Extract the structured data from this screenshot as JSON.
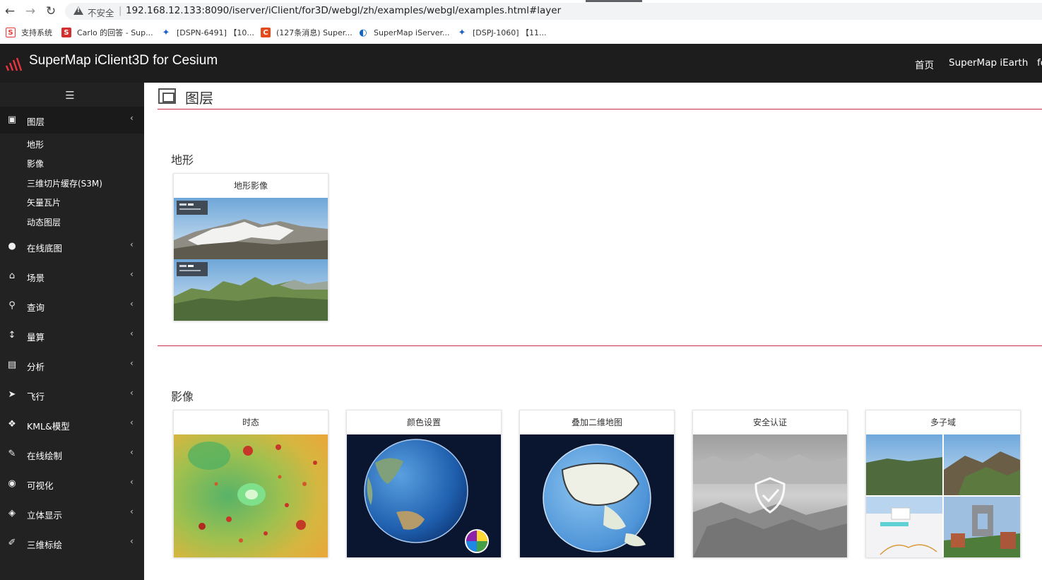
{
  "browser": {
    "back_icon": "arrow-left-icon",
    "forward_icon": "arrow-right-icon",
    "reload_icon": "reload-icon",
    "insecure_label": "不安全",
    "url": "192.168.12.133:8090/iserver/iClient/for3D/webgl/zh/examples/webgl/examples.html#layer"
  },
  "bookmarks": [
    {
      "label": "支持系统",
      "color": "#e53935",
      "glyph": "S"
    },
    {
      "label": "Carlo 的回答 - Sup...",
      "color": "#d32f2f",
      "glyph": "S"
    },
    {
      "label": "[DSPN-6491] 【10...",
      "color": "#1e63c8",
      "glyph": "✦"
    },
    {
      "label": "(127条消息) Super...",
      "color": "#e64a19",
      "glyph": "C"
    },
    {
      "label": "SuperMap iServer...",
      "color": "#1565c0",
      "glyph": "◐"
    },
    {
      "label": "[DSPJ-1060] 【11...",
      "color": "#1e63c8",
      "glyph": "✦"
    }
  ],
  "header": {
    "title": "SuperMap iClient3D for Cesium",
    "links": [
      "首页",
      "SuperMap iEarth",
      "fo"
    ]
  },
  "sidebar": {
    "toggle_icon": "hamburger-icon",
    "items": [
      {
        "label": "图层",
        "icon": "layers-icon",
        "glyph": "▣",
        "active": true
      },
      {
        "label": "在线底图",
        "icon": "globe-icon",
        "glyph": "●"
      },
      {
        "label": "场景",
        "icon": "bank-icon",
        "glyph": "⌂"
      },
      {
        "label": "查询",
        "icon": "search-icon",
        "glyph": "⚲"
      },
      {
        "label": "量算",
        "icon": "ruler-icon",
        "glyph": "↕"
      },
      {
        "label": "分析",
        "icon": "map-icon",
        "glyph": "▤"
      },
      {
        "label": "飞行",
        "icon": "paper-plane-icon",
        "glyph": "➤"
      },
      {
        "label": "KML&模型",
        "icon": "cubes-icon",
        "glyph": "❖"
      },
      {
        "label": "在线绘制",
        "icon": "edit-icon",
        "glyph": "✎"
      },
      {
        "label": "可视化",
        "icon": "eye-icon",
        "glyph": "◉"
      },
      {
        "label": "立体显示",
        "icon": "cube-icon",
        "glyph": "◈"
      },
      {
        "label": "三维标绘",
        "icon": "pencil-icon",
        "glyph": "✐"
      }
    ],
    "sub_items": [
      "地形",
      "影像",
      "三维切片缓存(S3M)",
      "矢量瓦片",
      "动态图层"
    ]
  },
  "main": {
    "page_title": "图层",
    "sections": [
      {
        "title": "地形",
        "cards": [
          {
            "title": "地形影像"
          }
        ]
      },
      {
        "title": "影像",
        "cards": [
          {
            "title": "时态"
          },
          {
            "title": "颜色设置"
          },
          {
            "title": "叠加二维地图"
          },
          {
            "title": "安全认证"
          },
          {
            "title": "多子域"
          }
        ]
      }
    ]
  },
  "colors": {
    "header_bg": "#1d1d1d",
    "sidebar_bg": "#222222",
    "accent_rule": "#c93245"
  }
}
